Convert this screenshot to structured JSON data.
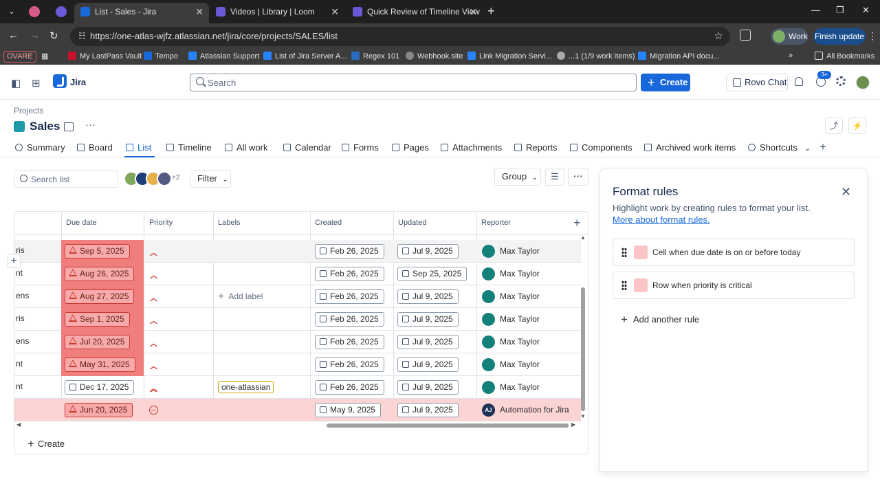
{
  "browser": {
    "tabs": [
      {
        "title": "List - Sales - Jira",
        "active": true
      },
      {
        "title": "Videos | Library | Loom",
        "active": false
      },
      {
        "title": "Quick Review of Timeline View",
        "active": false
      }
    ],
    "url": "https://one-atlas-wjfz.atlassian.net/jira/core/projects/SALES/list",
    "profile_label": "Work",
    "finish_update_label": "Finish update",
    "bookmarks": [
      "OVARE",
      "My LastPass Vault",
      "Tempo",
      "Atlassian Support",
      "List of Jira Server A...",
      "Regex 101",
      "Webhook.site",
      "Link Migration Servi...",
      "...1 (1/9 work items)",
      "Migration API docu..."
    ],
    "all_bookmarks_label": "All Bookmarks",
    "colors": {
      "chrome_dark": "#1f1f1f",
      "chrome_bar": "#3c3c3c"
    }
  },
  "jira": {
    "app_name": "Jira",
    "search_placeholder": "Search",
    "create_label": "Create",
    "rovo_label": "Rovo Chat",
    "notif_badge": "3+",
    "colors": {
      "brand": "#1868db",
      "overdue": "#f07e7e",
      "critical_row": "#fcd4d4"
    }
  },
  "project": {
    "breadcrumb": "Projects",
    "title": "Sales",
    "tabs": [
      "Summary",
      "Board",
      "List",
      "Timeline",
      "All work",
      "Calendar",
      "Forms",
      "Pages",
      "Attachments",
      "Reports",
      "Components",
      "Archived work items",
      "Shortcuts"
    ],
    "active_tab": "List"
  },
  "toolbar": {
    "search_placeholder": "Search list",
    "avatars_more": "+2",
    "filter_label": "Filter",
    "group_label": "Group"
  },
  "table": {
    "columns": [
      "Due date",
      "Priority",
      "Labels",
      "Created",
      "Updated",
      "Reporter"
    ],
    "rows": [
      {
        "summary_tail": "ris",
        "due": "Sep 5, 2025",
        "overdue": true,
        "priority": "minor",
        "label": "",
        "created": "Feb 26, 2025",
        "updated": "Jul 9, 2025",
        "reporter": "Max Taylor"
      },
      {
        "summary_tail": "nt",
        "due": "Aug 26, 2025",
        "overdue": true,
        "priority": "minor",
        "label": "",
        "created": "Feb 26, 2025",
        "updated": "Sep 25, 2025",
        "reporter": "Max Taylor"
      },
      {
        "summary_tail": "ens",
        "due": "Aug 27, 2025",
        "overdue": true,
        "priority": "minor",
        "label": "Add label",
        "created": "Feb 26, 2025",
        "updated": "Jul 9, 2025",
        "reporter": "Max Taylor"
      },
      {
        "summary_tail": "ris",
        "due": "Sep 1, 2025",
        "overdue": true,
        "priority": "minor",
        "label": "",
        "created": "Feb 26, 2025",
        "updated": "Jul 9, 2025",
        "reporter": "Max Taylor"
      },
      {
        "summary_tail": "ens",
        "due": "Jul 20, 2025",
        "overdue": true,
        "priority": "minor",
        "label": "",
        "created": "Feb 26, 2025",
        "updated": "Jul 9, 2025",
        "reporter": "Max Taylor"
      },
      {
        "summary_tail": "nt",
        "due": "May 31, 2025",
        "overdue": true,
        "priority": "minor",
        "label": "",
        "created": "Feb 26, 2025",
        "updated": "Jul 9, 2025",
        "reporter": "Max Taylor"
      },
      {
        "summary_tail": "nt",
        "due": "Dec 17, 2025",
        "overdue": false,
        "priority": "major",
        "label": "one-atlassian",
        "created": "Feb 26, 2025",
        "updated": "Jul 9, 2025",
        "reporter": "Max Taylor"
      },
      {
        "summary_tail": "",
        "due": "Jun 20, 2025",
        "overdue": true,
        "priority": "critical",
        "label": "",
        "created": "May 9, 2025",
        "updated": "Jul 9, 2025",
        "reporter": "Automation for Jira",
        "reporter_initials": "AJ"
      }
    ],
    "create_label": "Create"
  },
  "format_rules": {
    "title": "Format rules",
    "description": "Highlight work by creating rules to format your list.",
    "link": "More about format rules.",
    "rules": [
      {
        "text": "Cell when due date is on or before today",
        "color": "#fbc5c5"
      },
      {
        "text": "Row when priority is critical",
        "color": "#fbc5c5"
      }
    ],
    "add_rule_label": "Add another rule"
  }
}
